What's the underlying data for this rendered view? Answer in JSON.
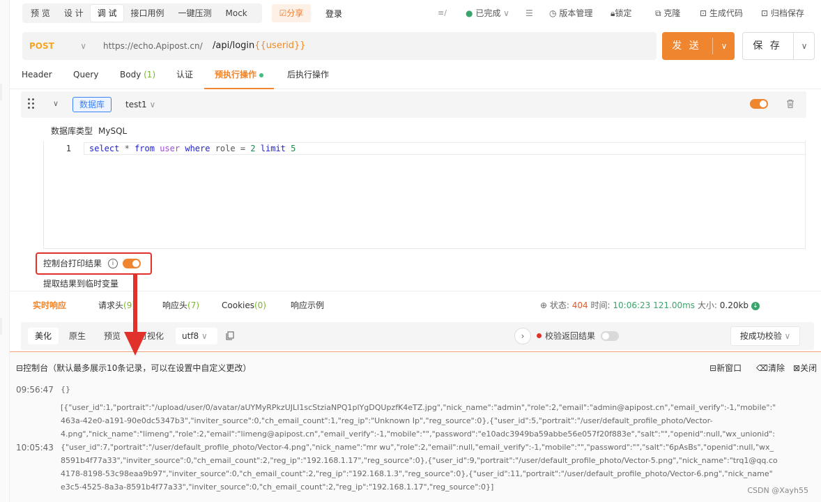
{
  "toolbar": {
    "tabs": [
      "预 览",
      "设 计",
      "调 试",
      "接口用例",
      "一键压测",
      "Mock"
    ],
    "share": "☑分享",
    "title": "登录",
    "status": "已完成",
    "version": "版本管理",
    "lock": "锁定",
    "clone": "克隆",
    "gencode": "生成代码",
    "archive": "归档保存"
  },
  "request": {
    "method": "POST",
    "host": "https://echo.Apipost.cn/",
    "path": "/api/login",
    "path_var": "{{userid}}",
    "send": "发 送",
    "save": "保 存"
  },
  "req_tabs": {
    "header": "Header",
    "query": "Query",
    "body": "Body",
    "body_count": "(1)",
    "auth": "认证",
    "pre": "预执行操作",
    "post": "后执行操作"
  },
  "db": {
    "tag": "数据库",
    "select": "test1",
    "type_label": "数据库类型",
    "type_value": "MySQL",
    "line_no": "1"
  },
  "code": {
    "select": "select",
    "star": "*",
    "from": "from",
    "table": "user",
    "where": "where",
    "field": "role",
    "eq": "=",
    "val": "2",
    "limit": "limit",
    "limit_val": "5"
  },
  "console_opt": {
    "print": "控制台打印结果",
    "extract": "提取结果到临时变量"
  },
  "res_tabs": {
    "realtime": "实时响应",
    "req_head": "请求头",
    "req_head_count": "(9)",
    "res_head": "响应头",
    "res_head_count": "(7)",
    "cookies": "Cookies",
    "cookies_count": "(0)",
    "example": "响应示例"
  },
  "status": {
    "status_label": "状态:",
    "status_value": "404",
    "time_label": "时间:",
    "time_value": "10:06:23",
    "duration": "121.00ms",
    "size_label": "大小:",
    "size_value": "0.20kb"
  },
  "view": {
    "beautify": "美化",
    "raw": "原生",
    "preview": "预览",
    "visual": "可视化",
    "encoding": "utf8",
    "validate": "校验返回结果",
    "validate_mode": "按成功校验"
  },
  "console": {
    "title": "控制台（默认最多展示10条记录，可以在设置中自定义更改）",
    "new_window": "新窗口",
    "clear": "清除",
    "close": "关闭",
    "entries": [
      {
        "time": "09:56:47",
        "text": "{}"
      },
      {
        "time": "10:05:43",
        "lines": [
          "[{\"user_id\":1,\"portrait\":\"/upload/user/0/avatar/aUYMyRPkzUJLI1scStziaNPQ1plYgDQUpzfK4eTZ.jpg\",\"nick_name\":\"admin\",\"role\":2,\"email\":\"admin@apipost.cn\",\"email_verify\":-1,\"mobile\":\"",
          "463a-42e0-a191-90e0dc5347b3\",\"inviter_source\":0,\"ch_email_count\":1,\"reg_ip\":\"Unknown Ip\",\"reg_source\":0},{\"user_id\":5,\"portrait\":\"/user/default_profile_photo/Vector-",
          "4.png\",\"nick_name\":\"limeng\",\"role\":2,\"email\":\"limeng@apipost.cn\",\"email_verify\":-1,\"mobile\":\"\",\"password\":\"e10adc3949ba59abbe56e057f20f883e\",\"salt\":\"\",\"openid\":null,\"wx_unionid\":",
          "{\"user_id\":7,\"portrait\":\"/user/default_profile_photo/Vector-4.png\",\"nick_name\":\"mr wu\",\"role\":2,\"email\":null,\"email_verify\":-1,\"mobile\":\"\",\"password\":\"\",\"salt\":\"6pAsBs\",\"openid\":null,\"wx_",
          "8591b4f77a33\",\"inviter_source\":0,\"ch_email_count\":2,\"reg_ip\":\"192.168.1.17\",\"reg_source\":0},{\"user_id\":9,\"portrait\":\"/user/default_profile_photo/Vector-5.png\",\"nick_name\":\"trq1@qq.co",
          "4178-8198-53c98eaa9b97\",\"inviter_source\":0,\"ch_email_count\":2,\"reg_ip\":\"192.168.1.3\",\"reg_source\":0},{\"user_id\":11,\"portrait\":\"/user/default_profile_photo/Vector-6.png\",\"nick_name\"",
          "e3c5-4525-8a3a-8591b4f77a33\",\"inviter_source\":0,\"ch_email_count\":2,\"reg_ip\":\"192.168.1.17\",\"reg_source\":0}]"
        ]
      }
    ]
  },
  "watermark": "CSDN @Xayh55",
  "colors": {
    "accent": "#f0852f",
    "highlight_box": "#e0312a",
    "db_tag": "#3b82f6",
    "success": "#3aa56a"
  },
  "toggles": {
    "pre_op_enabled": true,
    "console_print": true,
    "validate_result": false
  }
}
